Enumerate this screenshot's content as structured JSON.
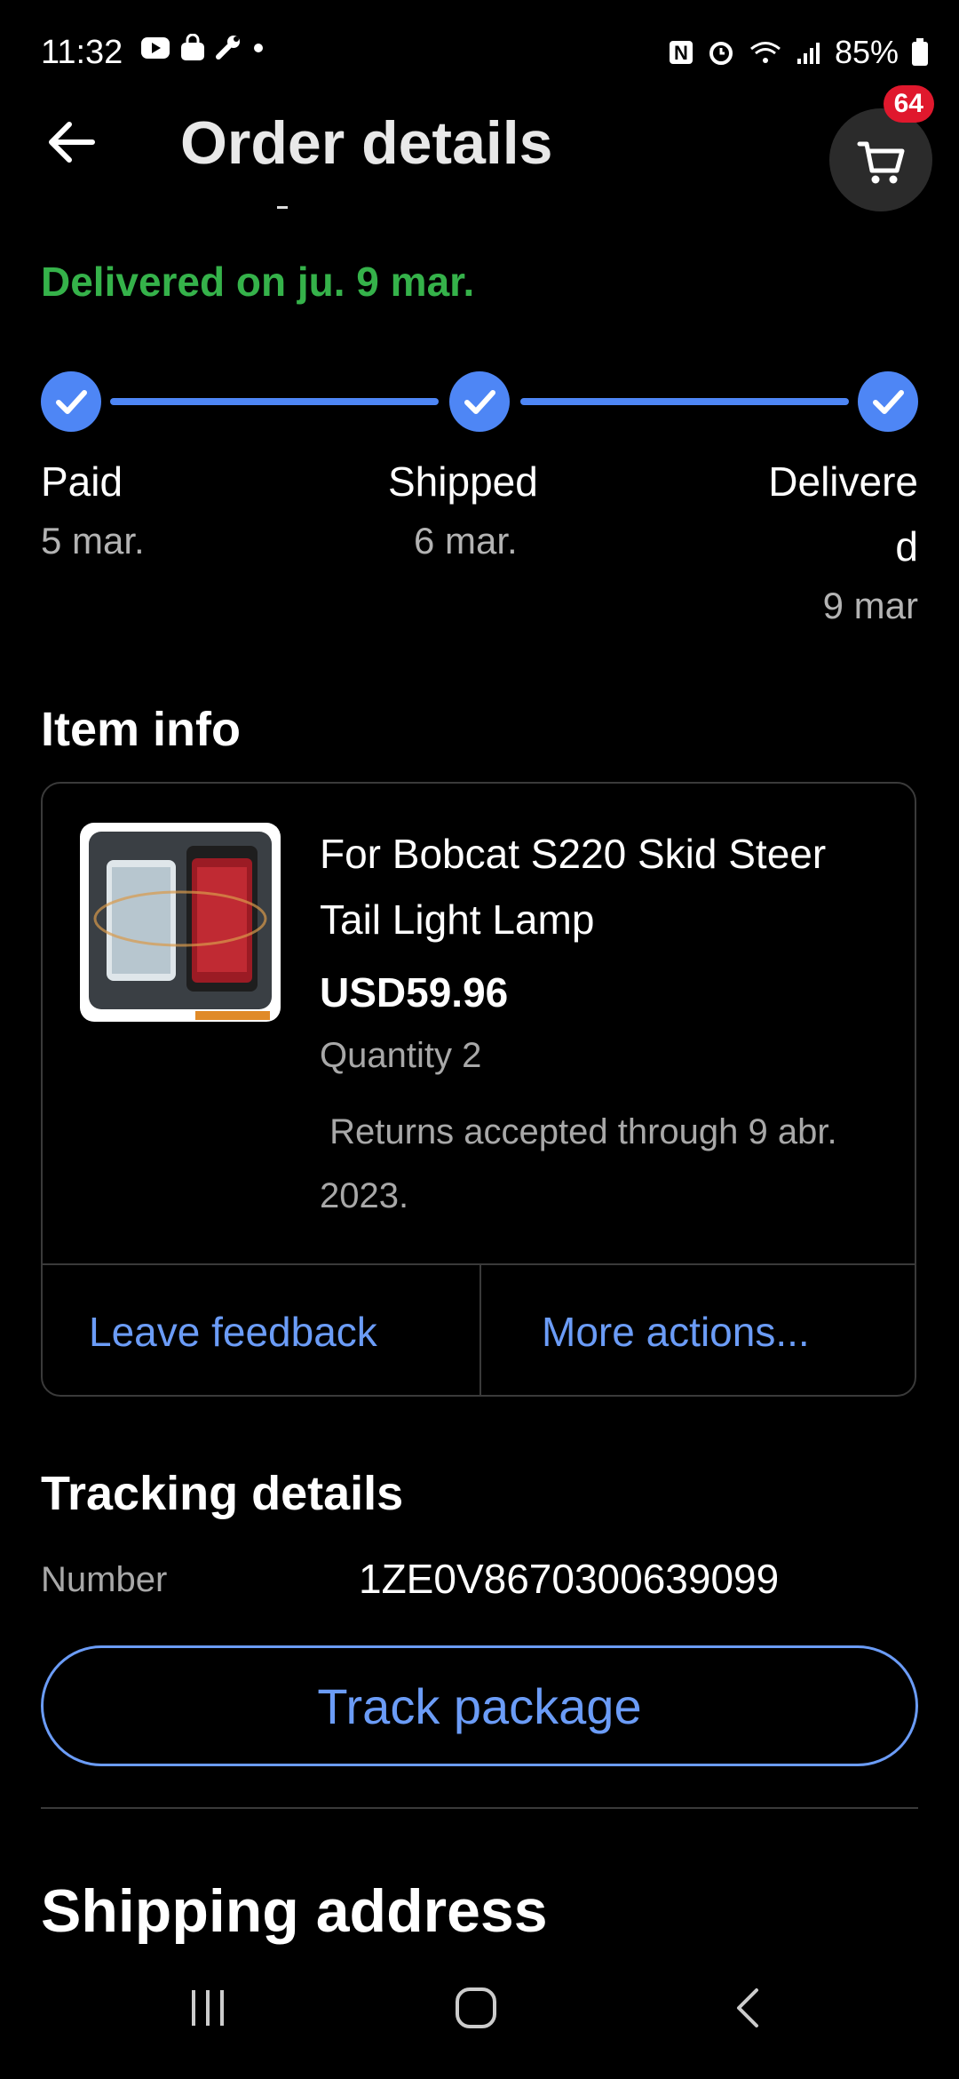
{
  "status_bar": {
    "time": "11:32",
    "battery": "85%"
  },
  "header": {
    "title": "Order details",
    "cart_count": "64"
  },
  "status": {
    "delivered": "Delivered on ju. 9 mar."
  },
  "progress": {
    "steps": [
      {
        "label": "Paid",
        "date": "5 mar."
      },
      {
        "label": "Shipped",
        "date": "6 mar."
      },
      {
        "label_line1": "Delivere",
        "label_line2": "d",
        "date": "9 mar"
      }
    ]
  },
  "item_info": {
    "heading": "Item info",
    "title": "For Bobcat S220 Skid Steer Tail Light Lamp",
    "price": "USD59.96",
    "quantity": "Quantity 2",
    "returns": " Returns accepted through 9 abr. 2023.",
    "leave_feedback": "Leave feedback",
    "more_actions": "More actions..."
  },
  "tracking": {
    "heading": "Tracking details",
    "number_label": "Number",
    "number": "1ZE0V8670300639099",
    "track_button": "Track package"
  },
  "shipping": {
    "heading": "Shipping address"
  },
  "colors": {
    "accent_blue": "#4e86f5",
    "link_blue": "#6b9cf7",
    "delivered_green": "#35b24a",
    "badge_red": "#e0182d"
  }
}
